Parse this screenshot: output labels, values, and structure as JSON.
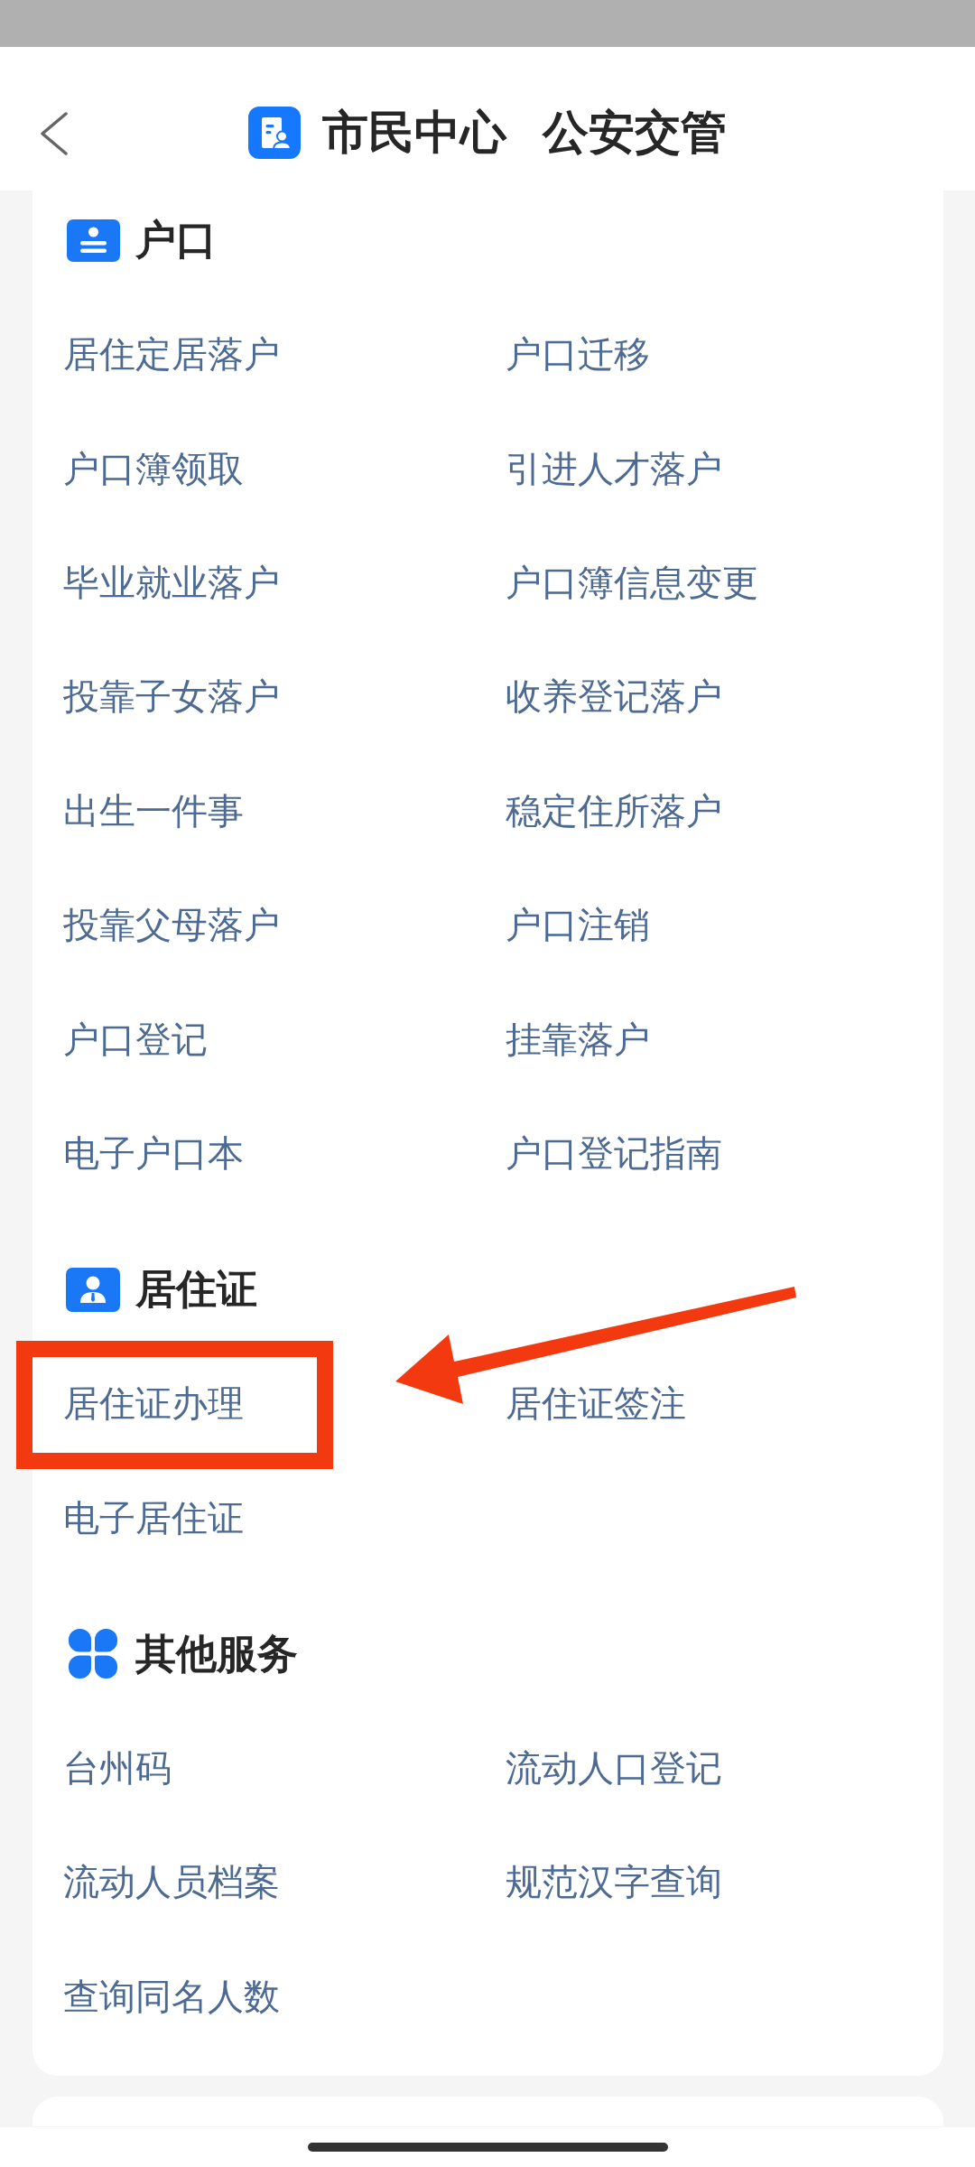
{
  "header": {
    "title": "市民中心",
    "subtitle": "公安交管"
  },
  "sections": [
    {
      "kind": "household",
      "title": "户口",
      "items": [
        {
          "label": "居住定居落户",
          "highlighted": false
        },
        {
          "label": "户口迁移",
          "highlighted": false
        },
        {
          "label": "户口簿领取",
          "highlighted": false
        },
        {
          "label": "引进人才落户",
          "highlighted": false
        },
        {
          "label": "毕业就业落户",
          "highlighted": false
        },
        {
          "label": "户口簿信息变更",
          "highlighted": false
        },
        {
          "label": "投靠子女落户",
          "highlighted": false
        },
        {
          "label": "收养登记落户",
          "highlighted": false
        },
        {
          "label": "出生一件事",
          "highlighted": false
        },
        {
          "label": "稳定住所落户",
          "highlighted": false
        },
        {
          "label": "投靠父母落户",
          "highlighted": false
        },
        {
          "label": "户口注销",
          "highlighted": false
        },
        {
          "label": "户口登记",
          "highlighted": false
        },
        {
          "label": "挂靠落户",
          "highlighted": false
        },
        {
          "label": "电子户口本",
          "highlighted": false
        },
        {
          "label": "户口登记指南",
          "highlighted": false
        }
      ]
    },
    {
      "kind": "residence",
      "title": "居住证",
      "items": [
        {
          "label": "居住证办理",
          "highlighted": true
        },
        {
          "label": "居住证签注",
          "highlighted": false
        },
        {
          "label": "电子居住证",
          "highlighted": false
        }
      ]
    },
    {
      "kind": "services",
      "title": "其他服务",
      "items": [
        {
          "label": "台州码",
          "highlighted": false
        },
        {
          "label": "流动人口登记",
          "highlighted": false
        },
        {
          "label": "流动人员档案",
          "highlighted": false
        },
        {
          "label": "规范汉字查询",
          "highlighted": false
        },
        {
          "label": "查询同名人数",
          "highlighted": false
        }
      ]
    }
  ]
}
